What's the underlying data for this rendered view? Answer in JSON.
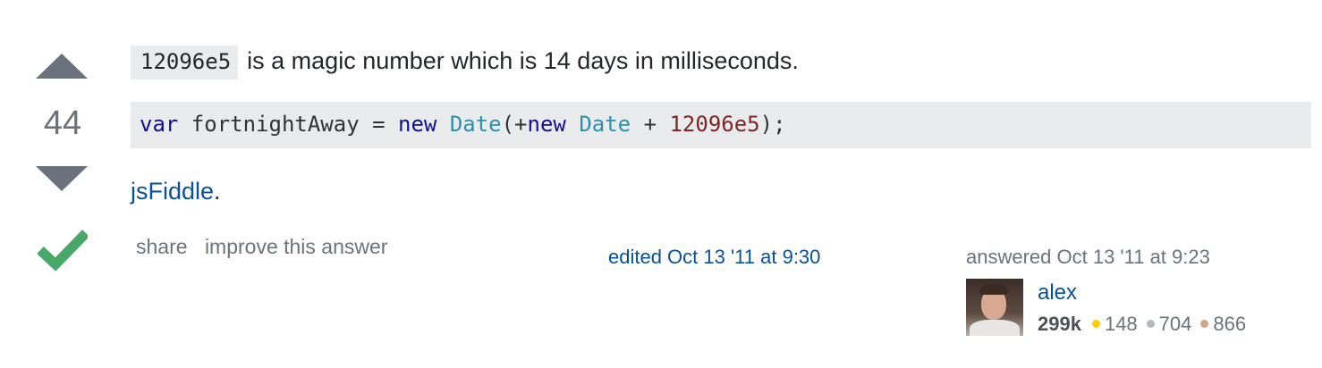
{
  "vote": {
    "count": "44"
  },
  "answer": {
    "inline_code": "12096e5",
    "intro_text": "is a magic number which is 14 days in milliseconds.",
    "code_block": {
      "tokens": [
        {
          "text": "var",
          "kind": "keyword"
        },
        {
          "text": " fortnightAway = ",
          "kind": "plain"
        },
        {
          "text": "new",
          "kind": "keyword"
        },
        {
          "text": " ",
          "kind": "plain"
        },
        {
          "text": "Date",
          "kind": "type"
        },
        {
          "text": "(+",
          "kind": "plain"
        },
        {
          "text": "new",
          "kind": "keyword"
        },
        {
          "text": " ",
          "kind": "plain"
        },
        {
          "text": "Date",
          "kind": "type"
        },
        {
          "text": " + ",
          "kind": "plain"
        },
        {
          "text": "12096e5",
          "kind": "number"
        },
        {
          "text": ");",
          "kind": "plain"
        }
      ]
    },
    "link_text": "jsFiddle",
    "link_suffix": "."
  },
  "menu": {
    "share_label": "share",
    "improve_label": "improve this answer"
  },
  "edited": {
    "text": "edited Oct 13 '11 at 9:30"
  },
  "answered": {
    "text": "answered Oct 13 '11 at 9:23"
  },
  "user": {
    "name": "alex",
    "reputation": "299k",
    "badges": [
      {
        "type": "gold",
        "count": "148",
        "color": "#ffcc01"
      },
      {
        "type": "silver",
        "count": "704",
        "color": "#b4b8bc"
      },
      {
        "type": "bronze",
        "count": "866",
        "color": "#d1a684"
      }
    ]
  },
  "colors": {
    "vote_arrow": "#6a737c",
    "accepted_check": "#48a868",
    "link": "#07509b",
    "code_background": "#eaebec"
  }
}
